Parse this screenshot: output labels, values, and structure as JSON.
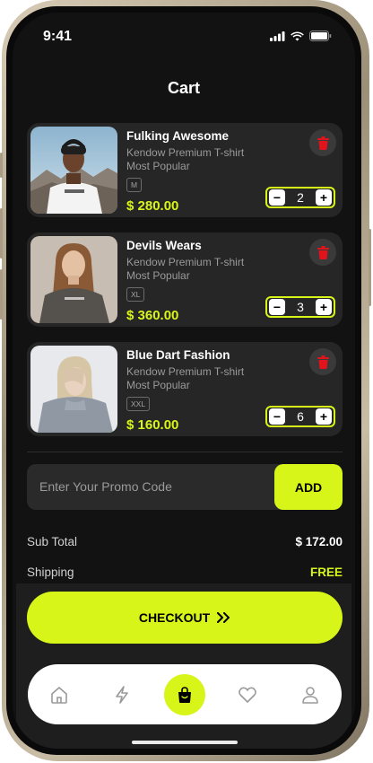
{
  "status": {
    "time": "9:41"
  },
  "header": {
    "title": "Cart"
  },
  "cart_items": [
    {
      "name": "Fulking Awesome",
      "line1": "Kendow Premium T-shirt",
      "line2": "Most Popular",
      "size": "M",
      "price": "$ 280.00",
      "qty": "2"
    },
    {
      "name": "Devils Wears",
      "line1": "Kendow Premium T-shirt",
      "line2": "Most Popular",
      "size": "XL",
      "price": "$ 360.00",
      "qty": "3"
    },
    {
      "name": "Blue Dart Fashion",
      "line1": "Kendow Premium T-shirt",
      "line2": "Most Popular",
      "size": "XXL",
      "price": "$ 160.00",
      "qty": "6"
    }
  ],
  "stepper": {
    "minus": "−",
    "plus": "+"
  },
  "promo": {
    "placeholder": "Enter Your Promo Code",
    "add_label": "ADD"
  },
  "summary": {
    "subtotal_label": "Sub Total",
    "subtotal_value": "$ 172.00",
    "shipping_label": "Shipping",
    "shipping_value": "FREE"
  },
  "checkout": {
    "label": "CHECKOUT",
    "icon": "double-chevron-right-icon"
  },
  "tabbar": {
    "items": [
      {
        "icon": "home-icon",
        "active": false
      },
      {
        "icon": "lightning-icon",
        "active": false
      },
      {
        "icon": "shopping-bag-icon",
        "active": true
      },
      {
        "icon": "heart-icon",
        "active": false
      },
      {
        "icon": "user-icon",
        "active": false
      }
    ]
  },
  "colors": {
    "accent": "#d8f51a",
    "background": "#121212",
    "card": "#262626",
    "delete": "#e3131b"
  }
}
